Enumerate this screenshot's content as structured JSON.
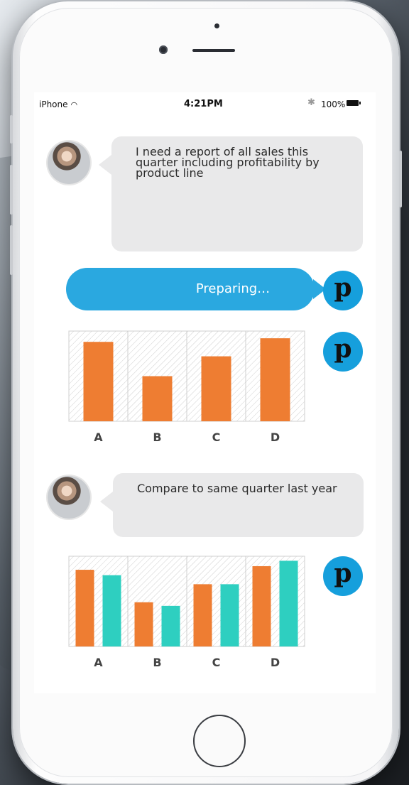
{
  "status_bar": {
    "carrier": "iPhone",
    "time": "4:21PM",
    "battery": "100%"
  },
  "messages": {
    "user_1": "I need a report of all sales this quarter including profitability by product line",
    "bot_reply": "Preparing…",
    "user_2": "Compare to same quarter last year",
    "bot_label": "p"
  },
  "colors": {
    "bot_bubble": "#2aa8e0",
    "bot_avatar": "#169fdc",
    "series_current": "#ee7d32",
    "series_last_year": "#2ecfc0"
  },
  "chart_data": [
    {
      "type": "bar",
      "categories": [
        "A",
        "B",
        "C",
        "D"
      ],
      "series": [
        {
          "values": [
            88,
            50,
            72,
            92
          ]
        }
      ],
      "ylim": [
        0,
        100
      ],
      "grid": false
    },
    {
      "type": "bar",
      "categories": [
        "A",
        "B",
        "C",
        "D"
      ],
      "series": [
        {
          "values": [
            85,
            49,
            69,
            89
          ]
        },
        {
          "values": [
            79,
            45,
            69,
            95
          ]
        }
      ],
      "ylim": [
        0,
        100
      ],
      "grid": false
    }
  ]
}
